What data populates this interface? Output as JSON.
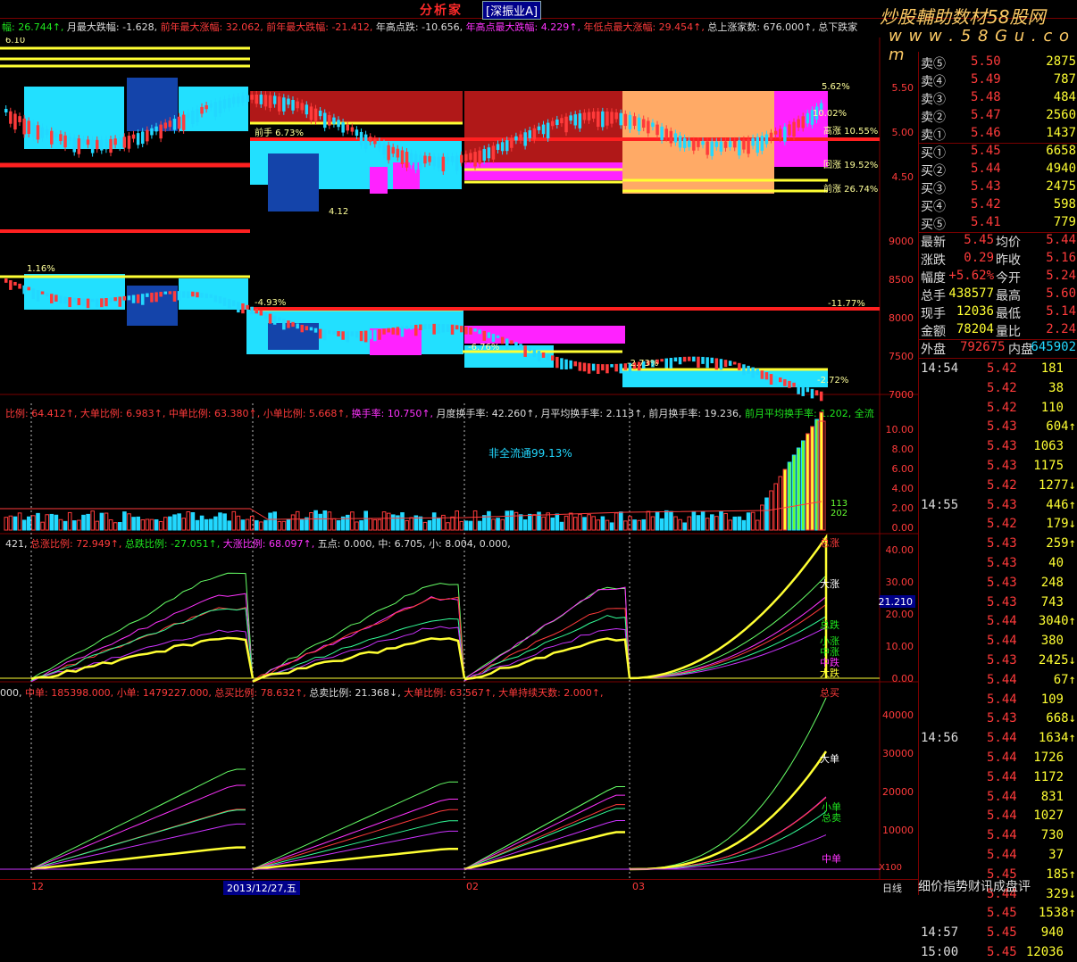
{
  "header": {
    "title": "分析家",
    "market": "[深振业A]",
    "watermark_line1": "炒股輔助数材58股网",
    "watermark_line2": "w w w . 5 8 G u . c o m",
    "stats": [
      {
        "t": "幅: 26.744↑, ",
        "c": "t-green"
      },
      {
        "t": "月最大跌幅: -1.628, ",
        "c": "t-white"
      },
      {
        "t": "前年最大涨幅: 32.062, ",
        "c": "t-red"
      },
      {
        "t": "前年最大跌幅: -21.412, ",
        "c": "t-red"
      },
      {
        "t": "年高点跌: -10.656, ",
        "c": "t-white"
      },
      {
        "t": "年高点最大跌幅: 4.229↑, ",
        "c": "t-mag"
      },
      {
        "t": "年低点最大涨幅: 29.454↑, ",
        "c": "t-red"
      },
      {
        "t": "总上涨家数: 676.000↑, ",
        "c": "t-white"
      },
      {
        "t": "总下跌家",
        "c": "t-white"
      }
    ]
  },
  "chart": {
    "price_scale": [
      "5.50",
      "5.00",
      "4.50"
    ],
    "price_tags": [
      "5.62%",
      "10.02%",
      "高涨 10.55%",
      "回涨 19.52%",
      "前涨 26.74%",
      "前手 6.73%",
      "4.12",
      "6.10"
    ],
    "index_scale": [
      "9000",
      "8500",
      "8000",
      "7500",
      "7000"
    ],
    "index_tags": [
      "1.16%",
      "-4.93%",
      "-11.77%",
      "-6.76%",
      "-2.73%",
      "-2.72%"
    ],
    "vol_scale": [
      "10.00",
      "8.00",
      "6.00",
      "4.00",
      "2.00",
      "0.00"
    ],
    "vol_header": [
      {
        "t": "比例: 64.412↑, ",
        "c": "t-red"
      },
      {
        "t": "大单比例: 6.983↑, ",
        "c": "t-red"
      },
      {
        "t": "中单比例: 63.380↑, ",
        "c": "t-red"
      },
      {
        "t": "小单比例: 5.668↑, ",
        "c": "t-red"
      },
      {
        "t": "换手率: 10.750↑, ",
        "c": "t-mag"
      },
      {
        "t": "月度换手率: 42.260↑, ",
        "c": "t-white"
      },
      {
        "t": "月平均换手率: 2.113↑, ",
        "c": "t-white"
      },
      {
        "t": "前月换手率: 19.236, ",
        "c": "t-white"
      },
      {
        "t": "前月平均换手率: 1.202, ",
        "c": "t-green"
      },
      {
        "t": "全流",
        "c": "t-green"
      }
    ],
    "vol_note": "非全流通99.13%",
    "vol_tags": [
      "113",
      "202"
    ],
    "ratio_header": [
      {
        "t": "421, ",
        "c": "t-white"
      },
      {
        "t": "总涨比例: 72.949↑, ",
        "c": "t-red"
      },
      {
        "t": "总跌比例: -27.051↑, ",
        "c": "t-green"
      },
      {
        "t": "大涨比例: 68.097↑, ",
        "c": "t-mag"
      },
      {
        "t": "五点: 0.000, ",
        "c": "t-white"
      },
      {
        "t": "中: 6.705, ",
        "c": "t-white"
      },
      {
        "t": "小: 8.004, ",
        "c": "t-white"
      },
      {
        "t": "0.000,",
        "c": "t-white"
      }
    ],
    "ratio_scale": [
      "40.00",
      "30.00",
      "20.00",
      "10.00",
      "0.00"
    ],
    "ratio_value": "21.210",
    "ratio_legend": [
      "总涨",
      "大涨",
      "总跌",
      "小涨",
      "中涨",
      "中跌",
      "大跌"
    ],
    "order_header": [
      {
        "t": "000, ",
        "c": "t-white"
      },
      {
        "t": "中单: 185398.000, ",
        "c": "t-red"
      },
      {
        "t": "小单: 1479227.000, ",
        "c": "t-red"
      },
      {
        "t": "总买比例: 78.632↑, ",
        "c": "t-red"
      },
      {
        "t": "总卖比例: 21.368↓, ",
        "c": "t-white"
      },
      {
        "t": "大单比例: 63.567↑, ",
        "c": "t-red"
      },
      {
        "t": "大单持续天数: 2.000↑, ",
        "c": "t-red"
      }
    ],
    "order_scale": [
      "40000",
      "30000",
      "20000",
      "10000"
    ],
    "order_legend": [
      "总买",
      "大单",
      "小单",
      "总卖",
      "中单"
    ],
    "order_unit": "X100",
    "x_labels": [
      "12",
      "2013/12/27,五",
      "02",
      "03"
    ],
    "period": "日线"
  },
  "quote": {
    "sells": [
      [
        "卖⑤",
        "5.50",
        "2875"
      ],
      [
        "卖④",
        "5.49",
        "787"
      ],
      [
        "卖③",
        "5.48",
        "484"
      ],
      [
        "卖②",
        "5.47",
        "2560"
      ],
      [
        "卖①",
        "5.46",
        "1437"
      ]
    ],
    "buys": [
      [
        "买①",
        "5.45",
        "6658"
      ],
      [
        "买②",
        "5.44",
        "4940"
      ],
      [
        "买③",
        "5.43",
        "2475"
      ],
      [
        "买④",
        "5.42",
        "598"
      ],
      [
        "买⑤",
        "5.41",
        "779"
      ]
    ],
    "info": [
      [
        "最新",
        "5.45",
        "均价",
        "5.44"
      ],
      [
        "涨跌",
        "0.29",
        "昨收",
        "5.16"
      ],
      [
        "幅度",
        "+5.62%",
        "今开",
        "5.24"
      ],
      [
        "总手",
        "438577",
        "最高",
        "5.60"
      ],
      [
        "现手",
        "12036",
        "最低",
        "5.14"
      ],
      [
        "金额",
        "78204",
        "量比",
        "2.24"
      ]
    ],
    "outer": [
      "外盘",
      "792675",
      "内盘",
      "645902"
    ],
    "ticks": [
      [
        "14:54",
        "5.42",
        "181",
        ""
      ],
      [
        "",
        "5.42",
        "38",
        ""
      ],
      [
        "",
        "5.42",
        "110",
        ""
      ],
      [
        "",
        "5.43",
        "604",
        "↑"
      ],
      [
        "",
        "5.43",
        "1063",
        ""
      ],
      [
        "",
        "5.43",
        "1175",
        ""
      ],
      [
        "",
        "5.42",
        "1277",
        "↓"
      ],
      [
        "14:55",
        "5.43",
        "446",
        "↑"
      ],
      [
        "",
        "5.42",
        "179",
        "↓"
      ],
      [
        "",
        "5.43",
        "259",
        "↑"
      ],
      [
        "",
        "5.43",
        "40",
        ""
      ],
      [
        "",
        "5.43",
        "248",
        ""
      ],
      [
        "",
        "5.43",
        "743",
        ""
      ],
      [
        "",
        "5.44",
        "3040",
        "↑"
      ],
      [
        "",
        "5.44",
        "380",
        ""
      ],
      [
        "",
        "5.43",
        "2425",
        "↓"
      ],
      [
        "",
        "5.44",
        "67",
        "↑"
      ],
      [
        "",
        "5.44",
        "109",
        ""
      ],
      [
        "",
        "5.43",
        "668",
        "↓"
      ],
      [
        "14:56",
        "5.44",
        "1634",
        "↑"
      ],
      [
        "",
        "5.44",
        "1726",
        ""
      ],
      [
        "",
        "5.44",
        "1172",
        ""
      ],
      [
        "",
        "5.44",
        "831",
        ""
      ],
      [
        "",
        "5.44",
        "1027",
        ""
      ],
      [
        "",
        "5.44",
        "730",
        ""
      ],
      [
        "",
        "5.44",
        "37",
        ""
      ],
      [
        "",
        "5.45",
        "185",
        "↑"
      ],
      [
        "",
        "5.44",
        "329",
        "↓"
      ],
      [
        "",
        "5.45",
        "1538",
        "↑"
      ],
      [
        "14:57",
        "5.45",
        "940",
        ""
      ],
      [
        "15:00",
        "5.45",
        "12036",
        ""
      ]
    ],
    "tabs": "细价指势财讯成盘评"
  },
  "colors": {
    "up": "#ff3b3b",
    "down": "#22d8ff",
    "frame": "#7a0000",
    "text": "#dddddd"
  }
}
